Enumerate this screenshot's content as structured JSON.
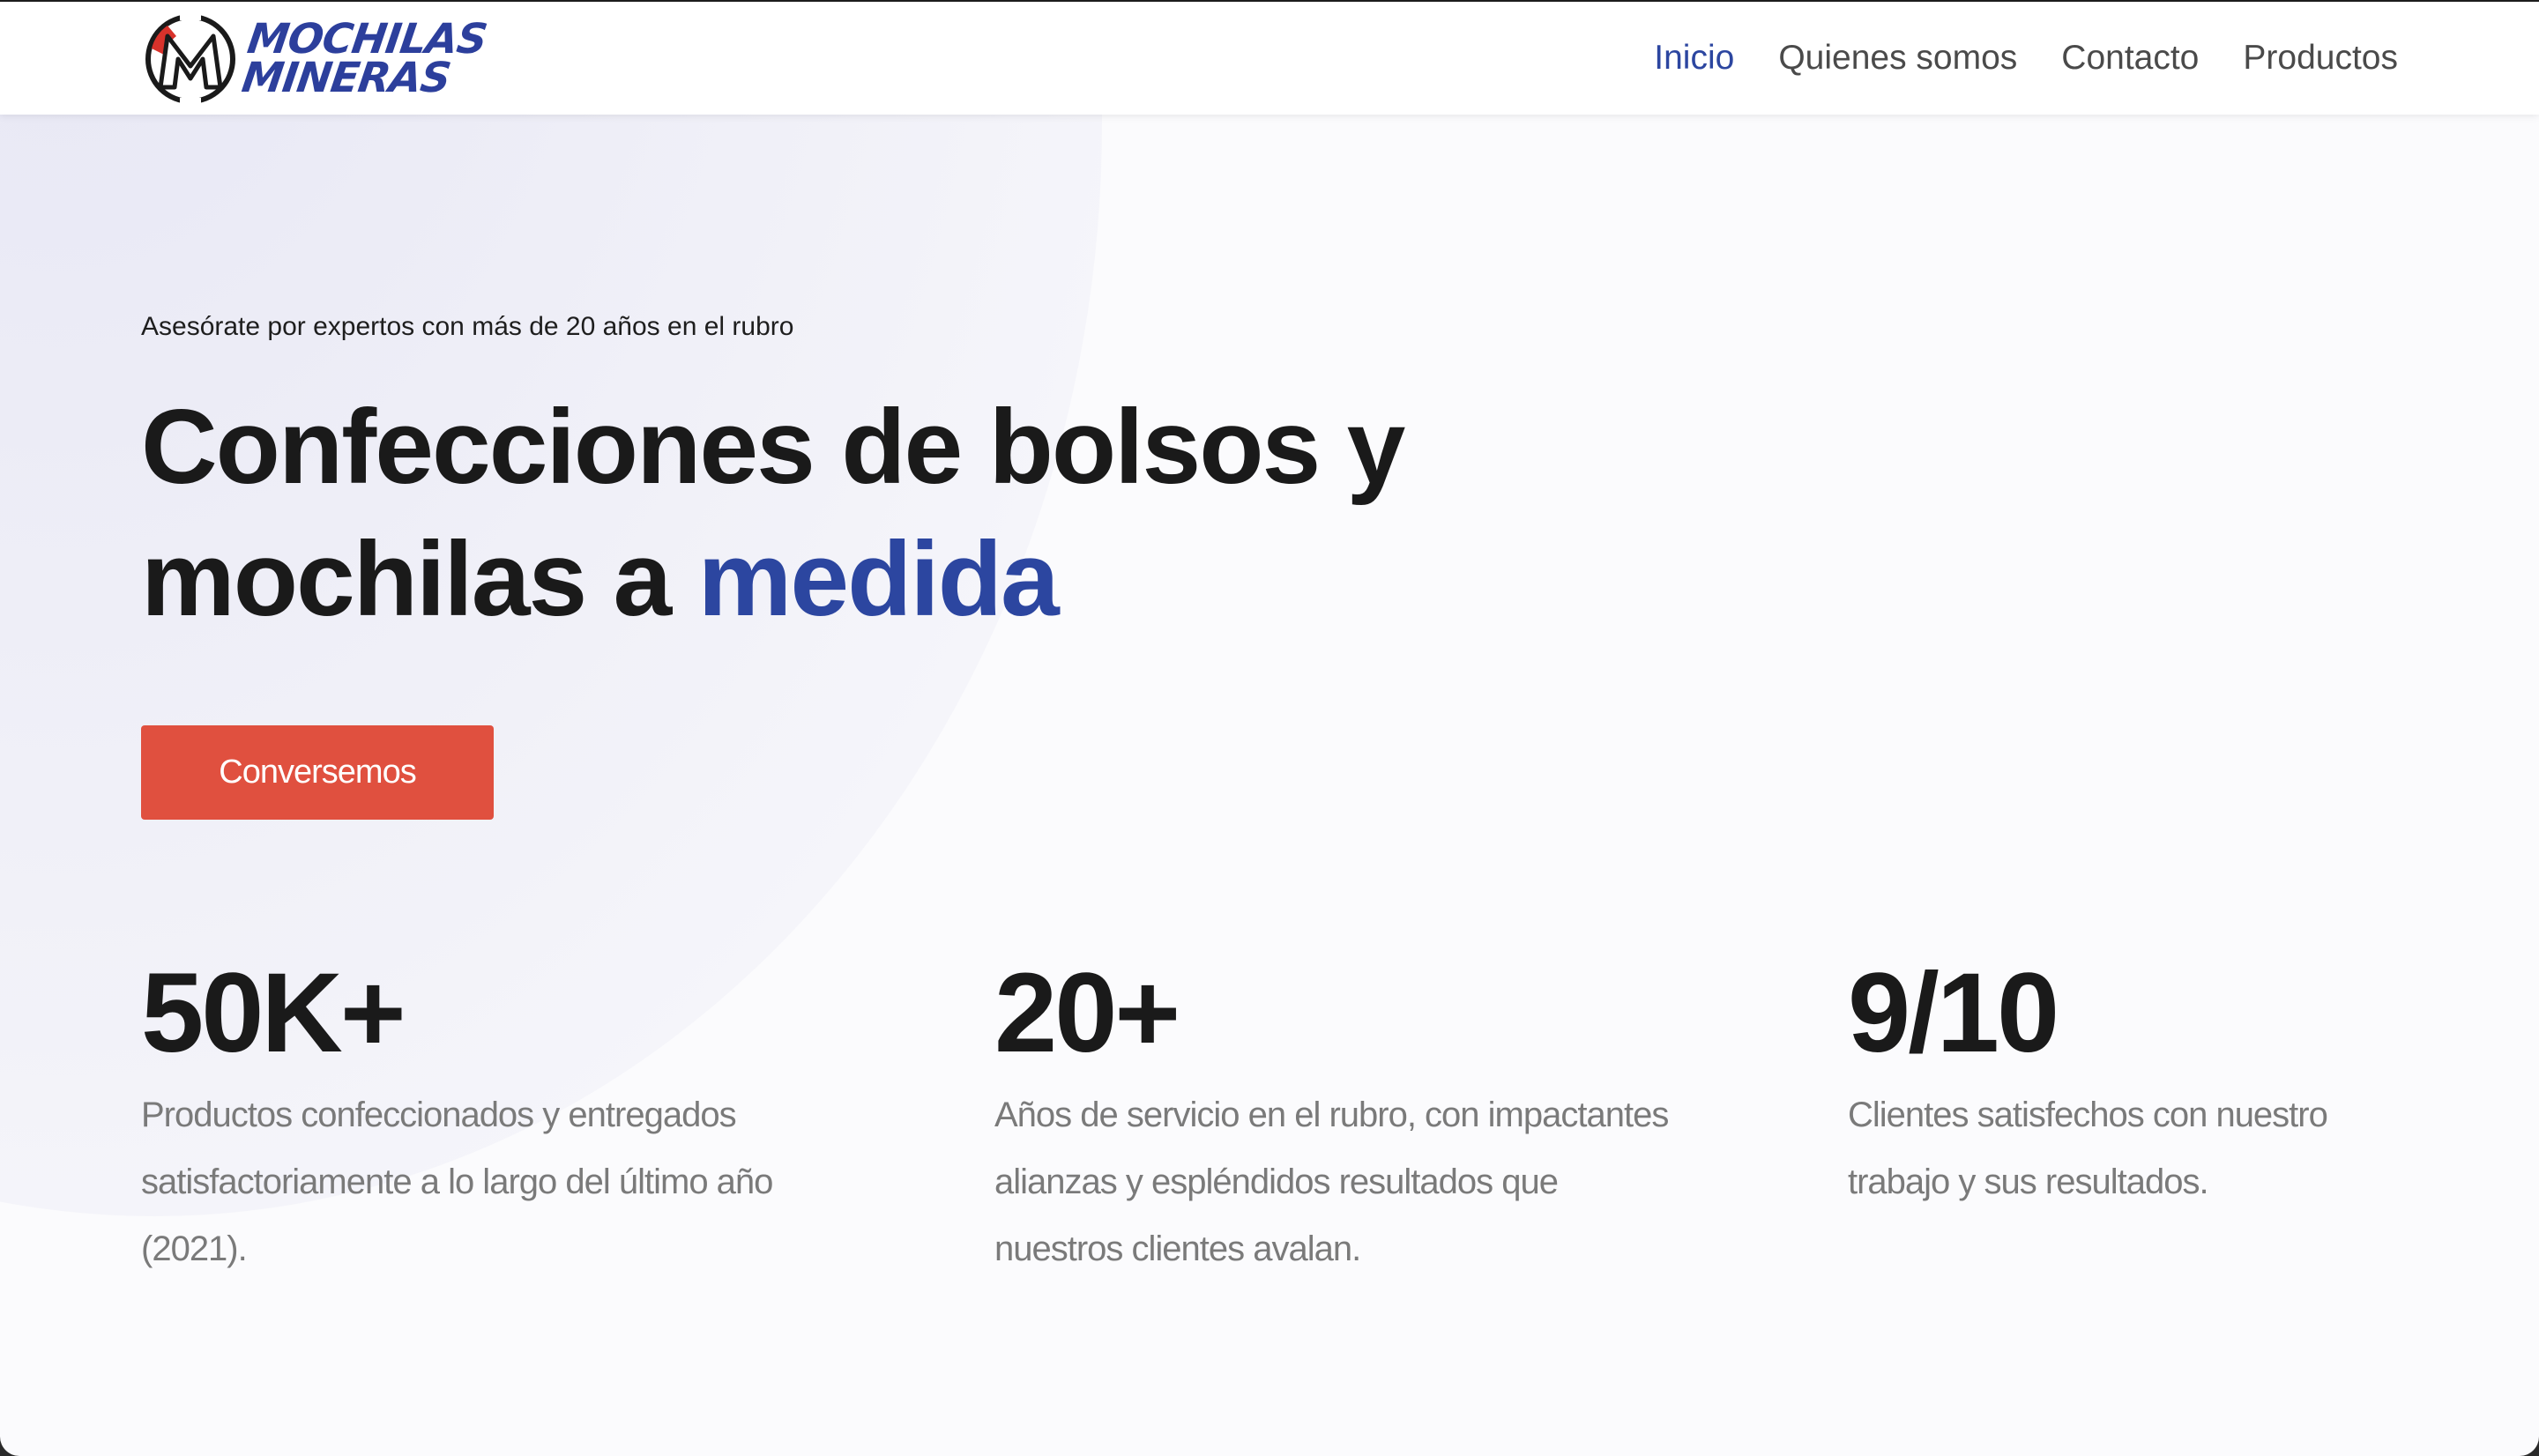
{
  "brand": {
    "logo_line1": "MOCHILAS",
    "logo_line2": "MINERAS",
    "primary_color": "#2c46a0",
    "accent_red": "#e0503f"
  },
  "nav": {
    "items": [
      {
        "label": "Inicio",
        "active": true
      },
      {
        "label": "Quienes somos",
        "active": false
      },
      {
        "label": "Contacto",
        "active": false
      },
      {
        "label": "Productos",
        "active": false
      }
    ]
  },
  "hero": {
    "eyebrow": "Asesórate por expertos con más de 20 años en el rubro",
    "headline_line1": "Confecciones de bolsos y",
    "headline_line2_prefix": "mochilas a ",
    "headline_line2_accent": "medida",
    "cta_label": "Conversemos"
  },
  "stats": [
    {
      "value": "50K+",
      "description": "Productos confeccionados y entregados satisfactoriamente a lo largo del último año (2021)."
    },
    {
      "value": "20+",
      "description": "Años de servicio en el rubro, con impactantes alianzas y espléndidos resultados que nuestros clientes avalan."
    },
    {
      "value": "9/10",
      "description": "Clientes satisfechos con nuestro trabajo y sus resultados."
    }
  ]
}
